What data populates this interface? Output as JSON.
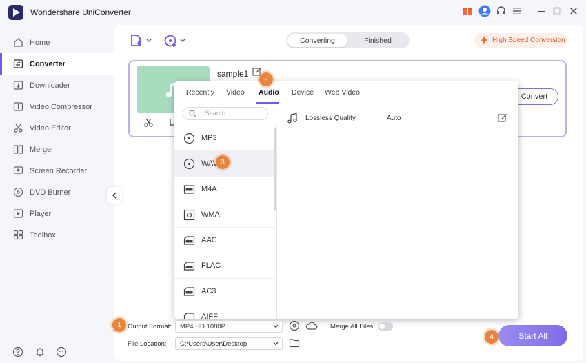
{
  "app": {
    "title": "Wondershare UniConverter"
  },
  "sidebar": {
    "items": [
      {
        "label": "Home",
        "icon": "home-icon"
      },
      {
        "label": "Converter",
        "icon": "converter-icon",
        "active": true
      },
      {
        "label": "Downloader",
        "icon": "downloader-icon"
      },
      {
        "label": "Video Compressor",
        "icon": "compress-icon"
      },
      {
        "label": "Video Editor",
        "icon": "scissors-icon"
      },
      {
        "label": "Merger",
        "icon": "merge-icon"
      },
      {
        "label": "Screen Recorder",
        "icon": "screen-record-icon"
      },
      {
        "label": "DVD Burner",
        "icon": "dvd-icon"
      },
      {
        "label": "Player",
        "icon": "player-icon"
      },
      {
        "label": "Toolbox",
        "icon": "toolbox-icon"
      }
    ]
  },
  "header": {
    "tabs": [
      "Converting",
      "Finished"
    ],
    "active_tab": "Converting",
    "high_speed_label": "High Speed Conversion"
  },
  "file": {
    "name": "sample1",
    "convert_label": "Convert"
  },
  "popup": {
    "tabs": [
      "Recently",
      "Video",
      "Audio",
      "Device",
      "Web Video"
    ],
    "active_tab": "Audio",
    "search_placeholder": "Search",
    "formats": [
      "MP3",
      "WAV",
      "M4A",
      "WMA",
      "AAC",
      "FLAC",
      "AC3",
      "AIFF"
    ],
    "selected_format": "WAV",
    "quality": {
      "name": "Lossless Quality",
      "value": "Auto"
    }
  },
  "bottom": {
    "output_format_label": "Output Format:",
    "output_format_value": "MP4 HD 1080P",
    "merge_label": "Merge All Files:",
    "file_location_label": "File Location:",
    "file_location_value": "C:\\Users\\User\\Desktop",
    "start_all_label": "Start All"
  },
  "steps": [
    "1",
    "2",
    "3",
    "4"
  ],
  "colors": {
    "accent": "#6c5ce7",
    "badge": "#e9843c",
    "speed": "#e45a1f",
    "thumb": "#a8dcbf"
  }
}
